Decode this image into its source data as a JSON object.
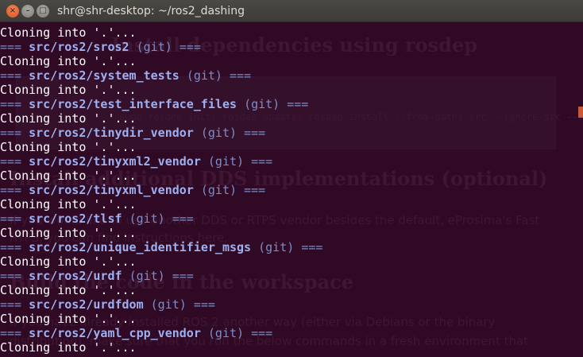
{
  "window": {
    "title": "shr@shr-desktop: ~/ros2_dashing",
    "buttons": {
      "close": "×",
      "minimize": "–",
      "maximize": "□"
    }
  },
  "background_doc": {
    "headings": [
      "Install dependencies using rosdep",
      "Install additional DDS implementations (optional)",
      "Build the code in the workspace"
    ],
    "paragraphs": [
      "If you would like to use another DDS or RTPS vendor besides the default, eProsima's Fast",
      "RTPS, you can find instructions here.",
      "If you have already installed ROS 2 another way (either via Debians or the binary",
      "distribution), make sure that you run the below commands in a fresh environment that"
    ],
    "code": "sudo rosdep init; rosdep update; rosdep install --from-paths src --ignore-src --rosdistro dashing -y --skip-keys \"console"
  },
  "terminal": {
    "prefix": "===",
    "suffix": "===",
    "vcs": "(git)",
    "lines": [
      {
        "kind": "out",
        "text": "Cloning into '.'..."
      },
      {
        "kind": "hdr",
        "path": "src/ros2/sros2"
      },
      {
        "kind": "out",
        "text": "Cloning into '.'..."
      },
      {
        "kind": "hdr",
        "path": "src/ros2/system_tests"
      },
      {
        "kind": "out",
        "text": "Cloning into '.'..."
      },
      {
        "kind": "hdr",
        "path": "src/ros2/test_interface_files"
      },
      {
        "kind": "out",
        "text": "Cloning into '.'..."
      },
      {
        "kind": "hdr",
        "path": "src/ros2/tinydir_vendor"
      },
      {
        "kind": "out",
        "text": "Cloning into '.'..."
      },
      {
        "kind": "hdr",
        "path": "src/ros2/tinyxml2_vendor"
      },
      {
        "kind": "out",
        "text": "Cloning into '.'..."
      },
      {
        "kind": "hdr",
        "path": "src/ros2/tinyxml_vendor"
      },
      {
        "kind": "out",
        "text": "Cloning into '.'..."
      },
      {
        "kind": "hdr",
        "path": "src/ros2/tlsf"
      },
      {
        "kind": "out",
        "text": "Cloning into '.'..."
      },
      {
        "kind": "hdr",
        "path": "src/ros2/unique_identifier_msgs"
      },
      {
        "kind": "out",
        "text": "Cloning into '.'..."
      },
      {
        "kind": "hdr",
        "path": "src/ros2/urdf"
      },
      {
        "kind": "out",
        "text": "Cloning into '.'..."
      },
      {
        "kind": "hdr",
        "path": "src/ros2/urdfdom"
      },
      {
        "kind": "out",
        "text": "Cloning into '.'..."
      },
      {
        "kind": "hdr",
        "path": "src/ros2/yaml_cpp_vendor"
      },
      {
        "kind": "out",
        "text": "Cloning into '.'..."
      }
    ]
  },
  "colors": {
    "terminal_bg": "#300a24",
    "output_text": "#ffffff",
    "header_path": "#9fb0f0",
    "header_meta": "#7d8cc7",
    "titlebar": "#3c3b37",
    "close_button": "#e95420"
  }
}
